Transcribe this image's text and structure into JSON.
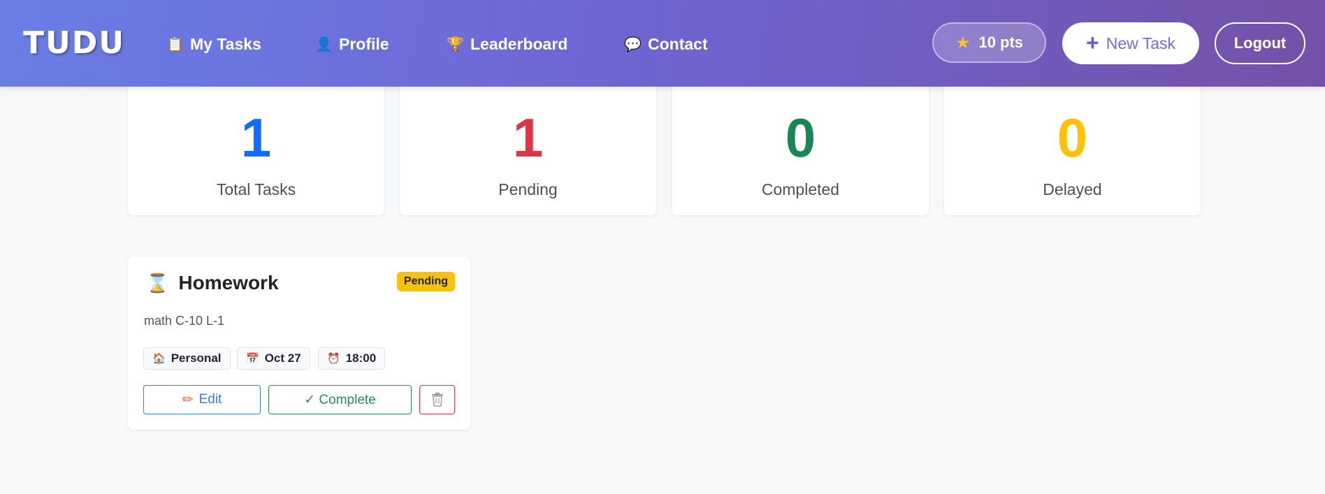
{
  "nav": {
    "brand": "TUDU",
    "links": [
      {
        "label": "My Tasks",
        "icon": "clipboard-icon",
        "glyph": "📋"
      },
      {
        "label": "Profile",
        "icon": "user-icon",
        "glyph": "👤"
      },
      {
        "label": "Leaderboard",
        "icon": "trophy-icon",
        "glyph": "🏆"
      },
      {
        "label": "Contact",
        "icon": "speech-bubble-icon",
        "glyph": "💬"
      }
    ],
    "points": "10 pts",
    "new_task": "New Task",
    "logout": "Logout"
  },
  "stats": [
    {
      "value": "1",
      "label": "Total Tasks",
      "color": "#0d6efd"
    },
    {
      "value": "1",
      "label": "Pending",
      "color": "#dc3545"
    },
    {
      "value": "0",
      "label": "Completed",
      "color": "#198754"
    },
    {
      "value": "0",
      "label": "Delayed",
      "color": "#ffc107"
    }
  ],
  "task": {
    "title": "Homework",
    "status": "Pending",
    "description": "math C-10 L-1",
    "category": "Personal",
    "date": "Oct 27",
    "time": "18:00",
    "actions": {
      "edit": "Edit",
      "complete": "✓ Complete"
    }
  },
  "colors": {
    "nav_gradient_start": "#6a7ee6",
    "nav_gradient_end": "#7451a8",
    "pending_badge": "#f8c00f"
  }
}
